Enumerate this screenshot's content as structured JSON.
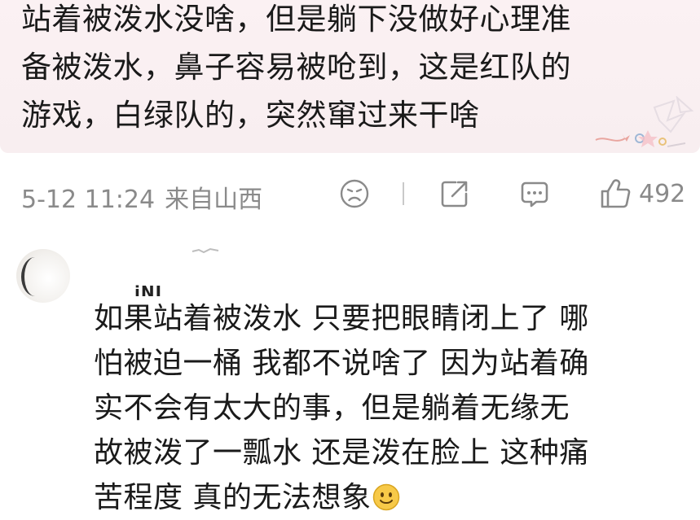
{
  "post": {
    "lines": [
      "站着被泼水没啥，但是躺下没做好心理准",
      "备被泼水，鼻子容易被呛到，这是红队的",
      "游戏，白绿队的，突然窜过来干啥"
    ]
  },
  "meta": {
    "datetime": "5-12 11:24",
    "location": "来自山西",
    "like_count": "492"
  },
  "reply": {
    "username": "iNI",
    "lines": [
      "如果站着被泼水 只要把眼睛闭上了 哪",
      "怕被迫一桶 我都不说啥了 因为站着确",
      "实不会有太大的事，但是躺着无缘无",
      "故被泼了一瓢水 还是泼在脸上 这种痛",
      "苦程度 真的无法想象"
    ],
    "emoji": "smile-emoji"
  },
  "colors": {
    "card_bg": "#f8eef0",
    "meta_text": "#8a8a8a",
    "body_text": "#1a1a1a",
    "emoji_fill": "#f7c948"
  },
  "icons": {
    "sad": "sad-face-icon",
    "share": "share-icon",
    "comment": "comment-icon",
    "like": "thumbs-up-icon"
  }
}
